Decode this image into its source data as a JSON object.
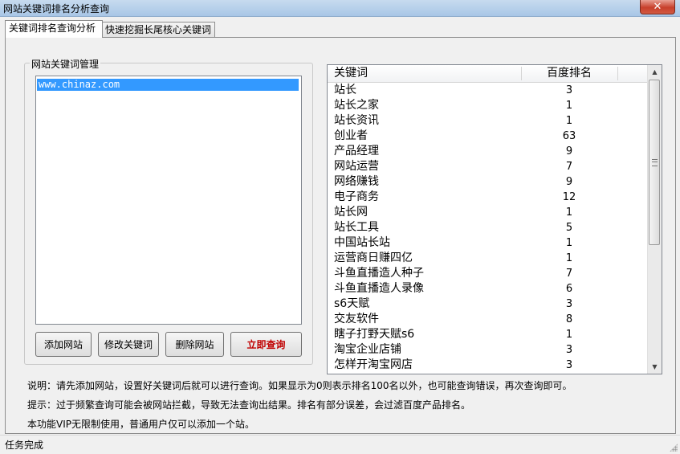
{
  "window": {
    "title": "网站关键词排名分析查询",
    "close_label": "✕"
  },
  "tabs": [
    {
      "label": "关键词排名查询分析"
    },
    {
      "label": "快速挖掘长尾核心关键词"
    }
  ],
  "site_group": {
    "title": "网站关键词管理",
    "sites": [
      "www.chinaz.com"
    ]
  },
  "buttons": {
    "add": "添加网站",
    "edit": "修改关键词",
    "delete": "删除网站",
    "query": "立即查询"
  },
  "table": {
    "headers": {
      "keyword": "关键词",
      "rank": "百度排名"
    },
    "rows": [
      {
        "keyword": "站长",
        "rank": "3"
      },
      {
        "keyword": "站长之家",
        "rank": "1"
      },
      {
        "keyword": "站长资讯",
        "rank": "1"
      },
      {
        "keyword": "创业者",
        "rank": "63"
      },
      {
        "keyword": "产品经理",
        "rank": "9"
      },
      {
        "keyword": "网站运营",
        "rank": "7"
      },
      {
        "keyword": "网络赚钱",
        "rank": "9"
      },
      {
        "keyword": "电子商务",
        "rank": "12"
      },
      {
        "keyword": "站长网",
        "rank": "1"
      },
      {
        "keyword": "站长工具",
        "rank": "5"
      },
      {
        "keyword": "中国站长站",
        "rank": "1"
      },
      {
        "keyword": "运营商日赚四亿",
        "rank": "1"
      },
      {
        "keyword": "斗鱼直播造人种子",
        "rank": "7"
      },
      {
        "keyword": "斗鱼直播造人录像",
        "rank": "6"
      },
      {
        "keyword": "s6天赋",
        "rank": "3"
      },
      {
        "keyword": "交友软件",
        "rank": "8"
      },
      {
        "keyword": "瞎子打野天赋s6",
        "rank": "1"
      },
      {
        "keyword": "淘宝企业店铺",
        "rank": "3"
      },
      {
        "keyword": "怎样开淘宝网店",
        "rank": "3"
      }
    ]
  },
  "notes": {
    "line1": "说明：请先添加网站，设置好关键词后就可以进行查询。如果显示为0则表示排名100名以外，也可能查询错误，再次查询即可。",
    "line2": "提示：过于频繁查询可能会被网站拦截，导致无法查询出结果。排名有部分误差，会过滤百度产品排名。",
    "line3": "本功能VIP无限制使用，普通用户仅可以添加一个站。"
  },
  "status": {
    "text": "任务完成"
  },
  "scrollbar": {
    "up_icon": "▲",
    "down_icon": "▼"
  }
}
